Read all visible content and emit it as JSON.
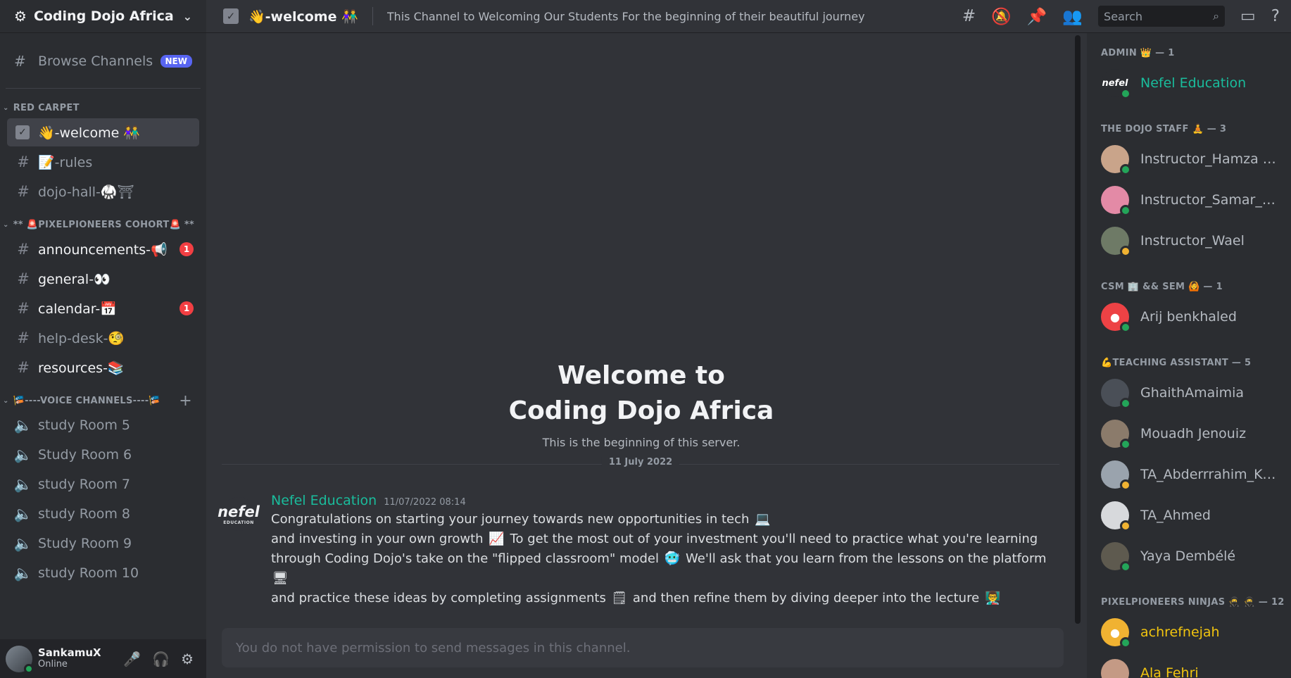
{
  "server": {
    "name": "Coding Dojo Africa",
    "browse_label": "Browse Channels",
    "new_badge": "NEW"
  },
  "categories": [
    {
      "label": "RED CARPET",
      "channels": [
        {
          "label": "👋-welcome 👫",
          "icon": "rules-check-icon"
        },
        {
          "label": "📝-rules",
          "icon": "hash-icon"
        },
        {
          "label": "dojo-hall-🥋⛩",
          "icon": "hash-icon"
        }
      ]
    },
    {
      "label": "** 🚨PIXELPIONEERS COHORT🚨 **",
      "channels": [
        {
          "label": "announcements-📢",
          "mentions": "1"
        },
        {
          "label": "general-👀"
        },
        {
          "label": "calendar-📅",
          "mentions": "1"
        },
        {
          "label": "help-desk-🧐"
        },
        {
          "label": "resources-📚"
        }
      ]
    },
    {
      "label": "🎏----VOICE CHANNELS----🎏",
      "channels": [
        {
          "label": "study Room 5"
        },
        {
          "label": "Study Room 6"
        },
        {
          "label": "study Room 7"
        },
        {
          "label": "study Room 8"
        },
        {
          "label": "Study Room 9"
        },
        {
          "label": "study Room 10"
        }
      ]
    }
  ],
  "user": {
    "name": "SankamuX",
    "status": "Online"
  },
  "topbar": {
    "channel": "👋-welcome 👫",
    "topic": "This Channel to Welcoming Our Students For the beginning of their beautiful journey",
    "search_placeholder": "Search"
  },
  "welcome": {
    "line1": "Welcome to",
    "line2": "Coding Dojo Africa",
    "sub": "This is the beginning of this server."
  },
  "date_divider": "11 July 2022",
  "message": {
    "author": "Nefel Education",
    "timestamp": "11/07/2022 08:14",
    "avatar_text": "nefel",
    "avatar_sub": "EDUCATION",
    "line1": "Congratulations on starting your journey towards new opportunities in tech",
    "line2a": "and investing in your own growth",
    "line2b": "To get the most out of your investment you'll need to practice what you're learning",
    "line3a": "through Coding Dojo's take on the \"flipped classroom\" model",
    "line3b": "We'll ask that you learn from the lessons on the platform",
    "line4a": "and practice these ideas by completing assignments",
    "line4b": "and then refine them by diving deeper into the lecture"
  },
  "input_placeholder": "You do not have permission to send messages in this channel.",
  "members": {
    "groups": [
      {
        "label": "ADMIN 👑 — 1"
      },
      {
        "label": "THE DOJO STAFF 🧘 — 3"
      },
      {
        "label": "CSM 🏢 && SEM 🙆 — 1"
      },
      {
        "label": "💪TEACHING ASSISTANT — 5"
      },
      {
        "label": "PIXELPIONEERS NINJAS 🥷 🥷 — 12"
      }
    ],
    "list": [
      {
        "name": "Nefel Education"
      },
      {
        "name": "Instructor_Hamza SA..."
      },
      {
        "name": "Instructor_Samar_BA..."
      },
      {
        "name": "Instructor_Wael"
      },
      {
        "name": "Arij benkhaled"
      },
      {
        "name": "GhaithAmaimia"
      },
      {
        "name": "Mouadh Jenouiz"
      },
      {
        "name": "TA_Abderrrahim_Kaa..."
      },
      {
        "name": "TA_Ahmed"
      },
      {
        "name": "Yaya Dembélé"
      },
      {
        "name": "achrefnejah"
      },
      {
        "name": "Ala Fehri"
      }
    ]
  }
}
